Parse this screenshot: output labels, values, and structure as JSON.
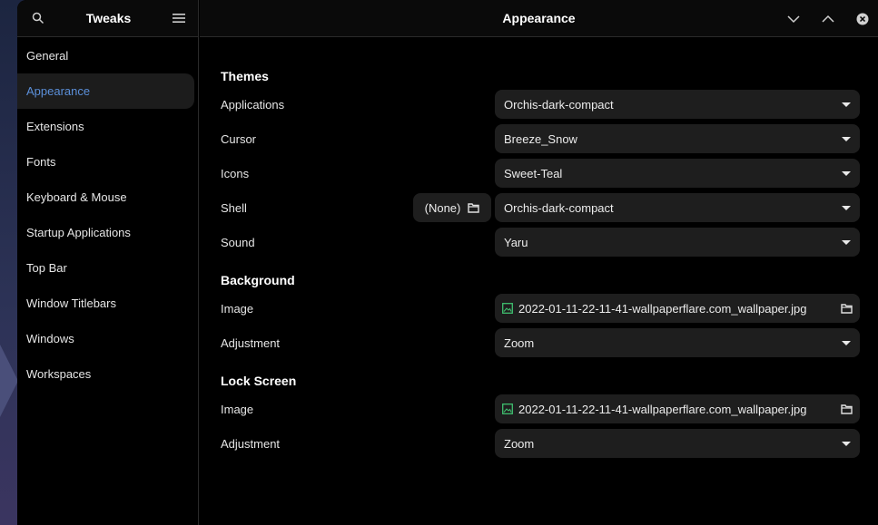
{
  "sidebar": {
    "title": "Tweaks",
    "items": [
      {
        "label": "General"
      },
      {
        "label": "Appearance"
      },
      {
        "label": "Extensions"
      },
      {
        "label": "Fonts"
      },
      {
        "label": "Keyboard & Mouse"
      },
      {
        "label": "Startup Applications"
      },
      {
        "label": "Top Bar"
      },
      {
        "label": "Window Titlebars"
      },
      {
        "label": "Windows"
      },
      {
        "label": "Workspaces"
      }
    ],
    "active_index": 1
  },
  "header": {
    "title": "Appearance"
  },
  "themes": {
    "title": "Themes",
    "applications": {
      "label": "Applications",
      "value": "Orchis-dark-compact"
    },
    "cursor": {
      "label": "Cursor",
      "value": "Breeze_Snow"
    },
    "icons": {
      "label": "Icons",
      "value": "Sweet-Teal"
    },
    "shell": {
      "label": "Shell",
      "value": "Orchis-dark-compact",
      "file_label": "(None)"
    },
    "sound": {
      "label": "Sound",
      "value": "Yaru"
    }
  },
  "background": {
    "title": "Background",
    "image": {
      "label": "Image",
      "value": "2022-01-11-22-11-41-wallpaperflare.com_wallpaper.jpg"
    },
    "adjustment": {
      "label": "Adjustment",
      "value": "Zoom"
    }
  },
  "lock_screen": {
    "title": "Lock Screen",
    "image": {
      "label": "Image",
      "value": "2022-01-11-22-11-41-wallpaperflare.com_wallpaper.jpg"
    },
    "adjustment": {
      "label": "Adjustment",
      "value": "Zoom"
    }
  },
  "colors": {
    "accent": "#5b8fd9",
    "window_bg": "#000000",
    "control_bg": "#1e1e1e",
    "image_icon": "#3fbf6f"
  }
}
